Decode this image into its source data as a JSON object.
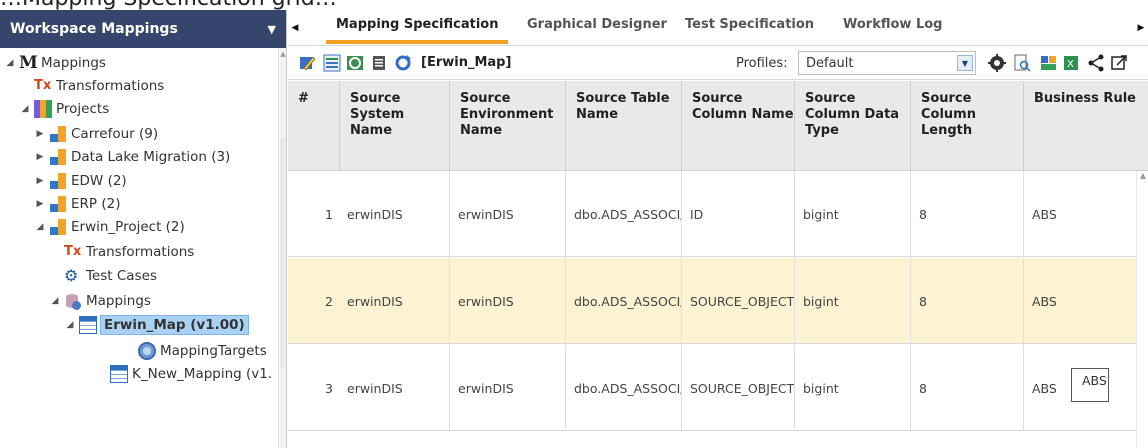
{
  "banner": {
    "text": "...Mapping Specification grid..."
  },
  "left_panel": {
    "title": "Workspace Mappings",
    "tree": [
      {
        "label": "Mappings",
        "icon": "mappings-root-icon"
      },
      {
        "label": "Transformations",
        "icon": "transformations-icon"
      },
      {
        "label": "Projects",
        "icon": "projects-icon"
      },
      {
        "label": "Carrefour (9)",
        "icon": "project-folder-icon"
      },
      {
        "label": "Data Lake Migration (3)",
        "icon": "project-folder-icon"
      },
      {
        "label": "EDW (2)",
        "icon": "project-folder-icon"
      },
      {
        "label": "ERP (2)",
        "icon": "project-folder-icon"
      },
      {
        "label": "Erwin_Project (2)",
        "icon": "project-folder-icon"
      },
      {
        "label": "Transformations",
        "icon": "transformations-icon"
      },
      {
        "label": "Test Cases",
        "icon": "test-cases-icon"
      },
      {
        "label": "Mappings",
        "icon": "mappings-db-icon"
      },
      {
        "label": "Erwin_Map (v1.00)",
        "icon": "mapping-table-icon"
      },
      {
        "label": "MappingTargets",
        "icon": "globe-icon"
      },
      {
        "label": "K_New_Mapping (v1.",
        "icon": "mapping-table-icon"
      }
    ]
  },
  "tabs": [
    {
      "label": "Mapping Specification",
      "active": true
    },
    {
      "label": "Graphical Designer",
      "active": false
    },
    {
      "label": "Test Specification",
      "active": false
    },
    {
      "label": "Workflow Log",
      "active": false
    }
  ],
  "toolbar": {
    "map_name": "[Erwin_Map]",
    "profiles_label": "Profiles:",
    "profiles_value": "Default"
  },
  "grid": {
    "columns": [
      "#",
      "Source System Name",
      "Source Environment Name",
      "Source Table Name",
      "Source Column Name",
      "Source Column Data Type",
      "Source Column Length",
      "Business Rule"
    ],
    "rows": [
      [
        "1",
        "erwinDIS",
        "erwinDIS",
        "dbo.ADS_ASSOCI/",
        "ID",
        "bigint",
        "8",
        "ABS"
      ],
      [
        "2",
        "erwinDIS",
        "erwinDIS",
        "dbo.ADS_ASSOCI/",
        "SOURCE_OBJECT_",
        "bigint",
        "8",
        "ABS"
      ],
      [
        "3",
        "erwinDIS",
        "erwinDIS",
        "dbo.ADS_ASSOCI/",
        "SOURCE_OBJECT_",
        "bigint",
        "8",
        "ABS"
      ]
    ]
  },
  "tooltip": {
    "text": "ABS"
  },
  "colors": {
    "header_bg": "#35456b",
    "accent": "#f4a025",
    "selected_row": "#fdf2d2",
    "tree_selection": "#a8d1f3"
  }
}
